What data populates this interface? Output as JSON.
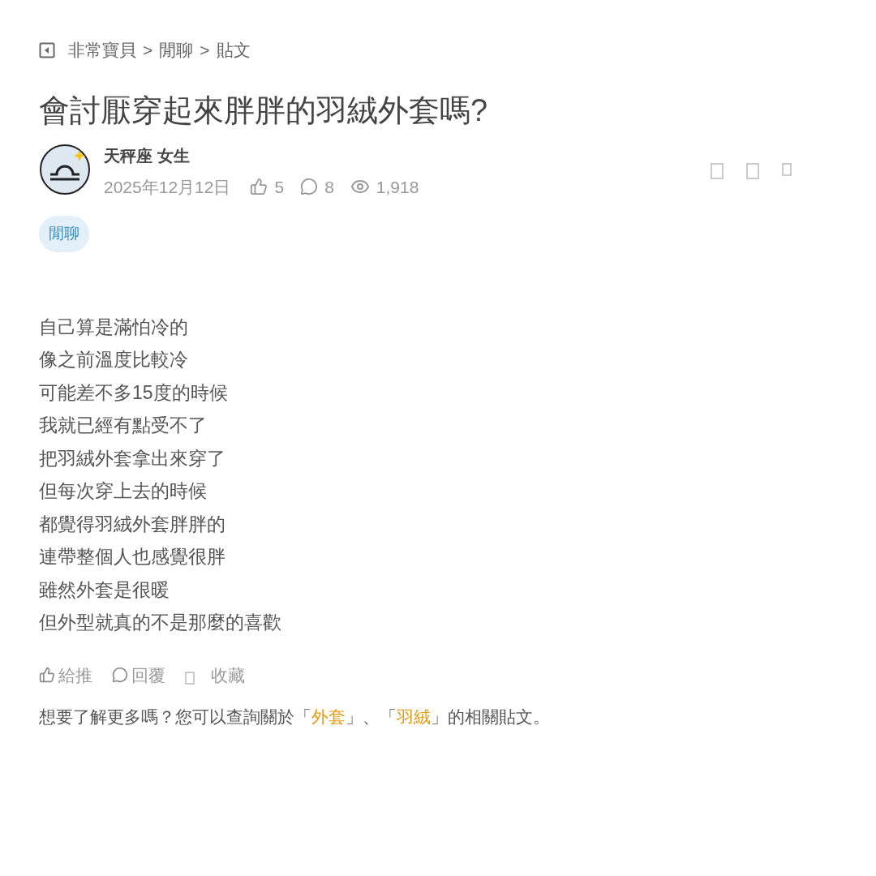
{
  "breadcrumb": [
    "非常寶貝",
    "閒聊",
    "貼文"
  ],
  "breadcrumb_separator": ">",
  "title": "會討厭穿起來胖胖的羽絨外套嗎?",
  "author": {
    "name": "天秤座 女生",
    "date": "2025年12月12日",
    "likes": "5",
    "comments": "8",
    "views": "1,918"
  },
  "tag": "閒聊",
  "body": [
    "自己算是滿怕冷的",
    "像之前溫度比較冷",
    "可能差不多15度的時候",
    "我就已經有點受不了",
    "把羽絨外套拿出來穿了",
    "但每次穿上去的時候",
    "都覺得羽絨外套胖胖的",
    "連帶整個人也感覺很胖",
    "雖然外套是很暖",
    "但外型就真的不是那麼的喜歡"
  ],
  "actions": [
    {
      "kind": "like",
      "label": "給推"
    },
    {
      "kind": "reply",
      "label": "回覆"
    },
    {
      "kind": "save",
      "label": "收藏"
    }
  ],
  "related": {
    "before": "想要了解更多嗎？您可以查詢關於「",
    "links": [
      "外套",
      "羽絨"
    ],
    "between": "」、「",
    "after": "」的相關貼文。"
  }
}
